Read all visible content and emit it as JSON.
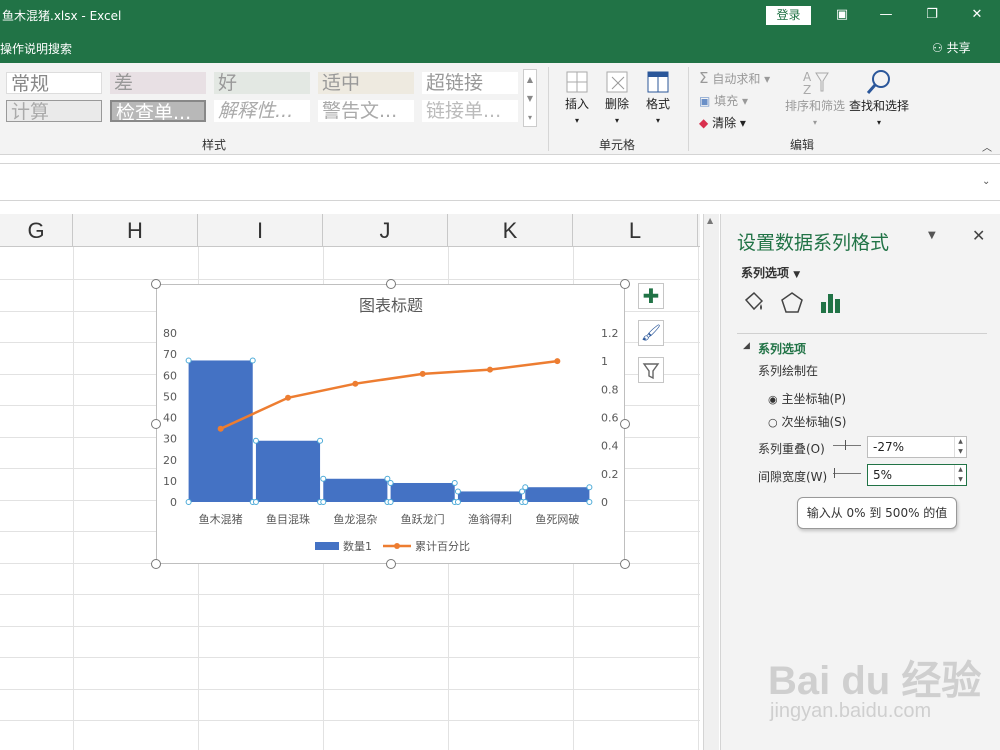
{
  "window": {
    "title": "鱼木混猪.xlsx  -  Excel",
    "login_label": "登录",
    "tellme_label": "操作说明搜索",
    "share_label": "共享"
  },
  "ribbon": {
    "styles": {
      "row1": [
        "常规",
        "差",
        "好",
        "适中",
        "超链接"
      ],
      "row2": [
        "计算",
        "检查单...",
        "解释性...",
        "警告文...",
        "链接单..."
      ],
      "group_label": "样式"
    },
    "cells": {
      "insert_label": "插入",
      "delete_label": "删除",
      "format_label": "格式",
      "group_label": "单元格"
    },
    "editing": {
      "autosum_label": "自动求和",
      "fill_label": "填充",
      "clear_label": "清除",
      "sort_filter_label": "排序和筛选",
      "find_select_label": "查找和选择",
      "group_label": "编辑"
    }
  },
  "grid": {
    "columns": [
      "G",
      "H",
      "I",
      "J",
      "K",
      "L"
    ]
  },
  "chart_data": {
    "type": "bar",
    "title": "图表标题",
    "categories": [
      "鱼木混猪",
      "鱼目混珠",
      "鱼龙混杂",
      "鱼跃龙门",
      "渔翁得利",
      "鱼死网破"
    ],
    "series": [
      {
        "name": "数量1",
        "type": "bar",
        "axis": "primary",
        "values": [
          67,
          29,
          11,
          9,
          5,
          7
        ],
        "color": "#4472c4"
      },
      {
        "name": "累计百分比",
        "type": "line",
        "axis": "secondary",
        "values": [
          0.52,
          0.74,
          0.84,
          0.91,
          0.94,
          1.0
        ],
        "color": "#ed7d31"
      }
    ],
    "ylim": [
      0,
      80
    ],
    "yticks": [
      "0",
      "10",
      "20",
      "30",
      "40",
      "50",
      "60",
      "70",
      "80"
    ],
    "y2lim": [
      0,
      1.2
    ],
    "y2ticks": [
      "0",
      "0.2",
      "0.4",
      "0.6",
      "0.8",
      "1",
      "1.2"
    ],
    "legend": "bottom"
  },
  "pane": {
    "title": "设置数据系列格式",
    "series_options_dropdown": "系列选项",
    "section_title": "系列选项",
    "plot_on_label": "系列绘制在",
    "primary_axis_label": "主坐标轴(P)",
    "secondary_axis_label": "次坐标轴(S)",
    "overlap_label": "系列重叠(O)",
    "overlap_value": "-27%",
    "gap_label": "间隙宽度(W)",
    "gap_value": "5%",
    "tooltip": "输入从 0% 到 500% 的值"
  },
  "watermark": {
    "brand": "Bai du 经验",
    "url": "jingyan.baidu.com"
  }
}
